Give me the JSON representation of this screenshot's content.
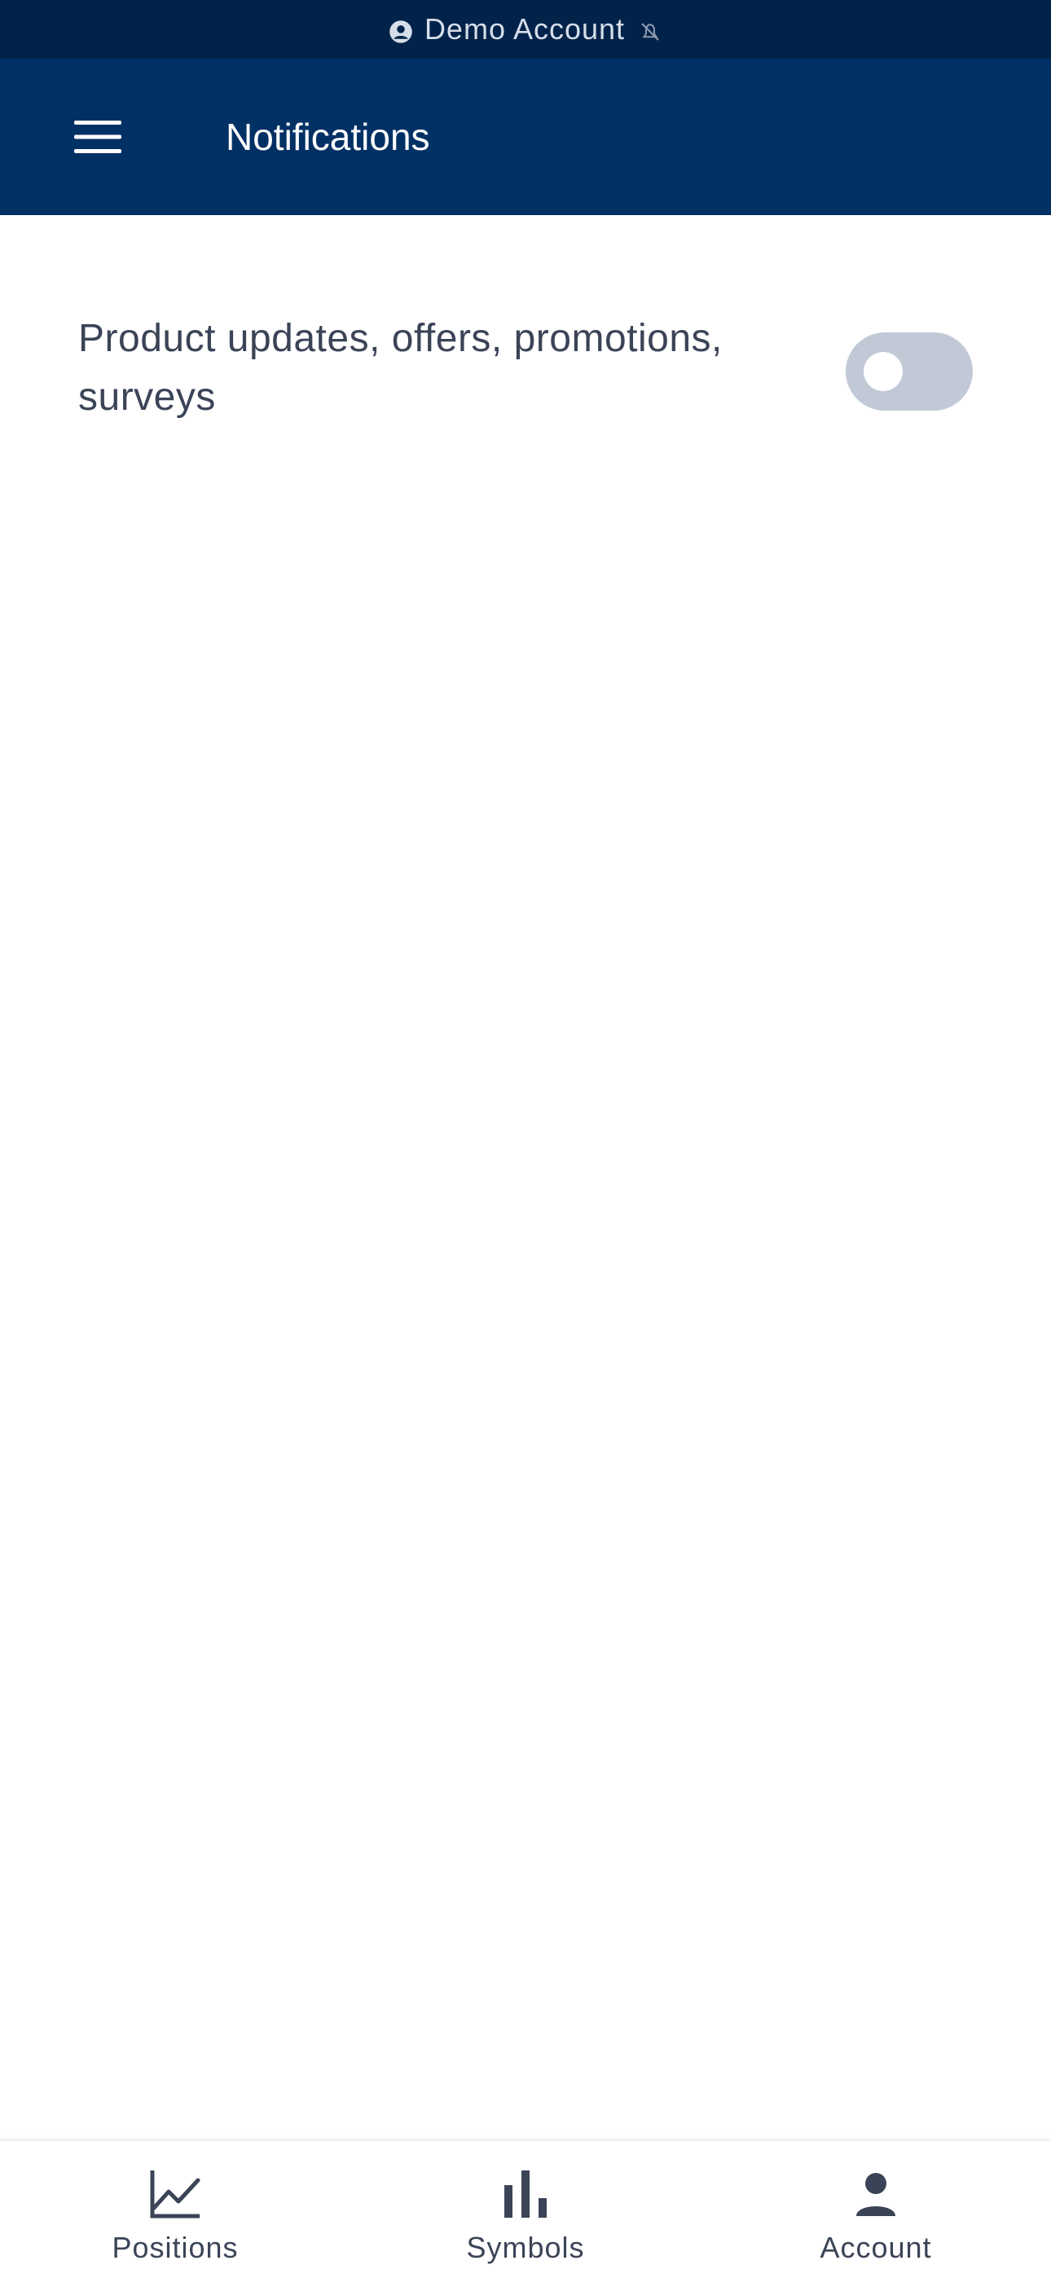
{
  "status_bar": {
    "account_label": "Demo Account",
    "account_icon": "account-circle-icon",
    "mute_icon": "notifications-off-icon"
  },
  "header": {
    "title": "Notifications",
    "menu_icon": "hamburger-menu-icon"
  },
  "settings": [
    {
      "label": "Product updates, offers, promotions, surveys",
      "enabled": false
    }
  ],
  "bottom_nav": {
    "items": [
      {
        "label": "Positions",
        "icon": "line-chart-icon"
      },
      {
        "label": "Symbols",
        "icon": "bar-chart-icon"
      },
      {
        "label": "Account",
        "icon": "person-icon"
      }
    ]
  },
  "colors": {
    "status_bg": "#01234a",
    "header_bg": "#003064",
    "toggle_off": "#c1c9d6",
    "text": "#3b4457"
  }
}
